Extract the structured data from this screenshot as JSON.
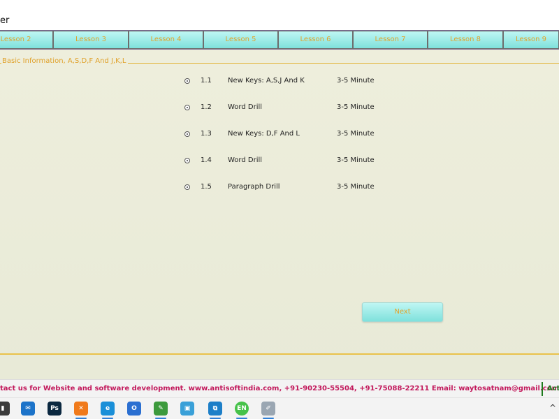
{
  "window": {
    "title_fragment": "er"
  },
  "tabs": [
    {
      "label": "Lesson 2"
    },
    {
      "label": "Lesson 3"
    },
    {
      "label": "Lesson 4"
    },
    {
      "label": "Lesson 5"
    },
    {
      "label": "Lesson 6"
    },
    {
      "label": "Lesson 7"
    },
    {
      "label": "Lesson 8"
    },
    {
      "label": "Lesson 9"
    }
  ],
  "group": {
    "label": "Basic Information, A,S,D,F And J,K,L"
  },
  "lessons": [
    {
      "num": "1.1",
      "title": "New Keys: A,S,J And K",
      "duration": "3-5 Minute"
    },
    {
      "num": "1.2",
      "title": "Word Drill",
      "duration": "3-5 Minute"
    },
    {
      "num": "1.3",
      "title": "New Keys: D,F And L",
      "duration": "3-5 Minute"
    },
    {
      "num": "1.4",
      "title": "Word Drill",
      "duration": "3-5 Minute"
    },
    {
      "num": "1.5",
      "title": "Paragraph Drill",
      "duration": "3-5 Minute"
    }
  ],
  "next_button": {
    "label": "Next"
  },
  "footer": {
    "contact_text": "tact us for Website and software development. www.antisoftindia.com, +91-90230-55504, +91-75088-22211  Email: waytosatnam@gmail.com",
    "right_text": "Act"
  },
  "taskbar": {
    "icons": [
      {
        "name": "store-icon",
        "glyph": "▮",
        "color": "#3a3a3a"
      },
      {
        "name": "mail-icon",
        "glyph": "✉",
        "color": "#1c73c9"
      },
      {
        "name": "photoshop-icon",
        "glyph": "Ps",
        "color": "#0b2840"
      },
      {
        "name": "xampp-icon",
        "glyph": "✕",
        "color": "#f07a1b"
      },
      {
        "name": "edge-icon",
        "glyph": "e",
        "color": "#1a8fd8"
      },
      {
        "name": "outlook-icon",
        "glyph": "O",
        "color": "#2b6fd1"
      },
      {
        "name": "notepad-icon",
        "glyph": "✎",
        "color": "#3c9a3c"
      },
      {
        "name": "remote-desktop-icon",
        "glyph": "▣",
        "color": "#3aa0d8"
      },
      {
        "name": "quick-assist-icon",
        "glyph": "⧉",
        "color": "#1d7fc8"
      },
      {
        "name": "typing-tutor-icon",
        "glyph": "EN",
        "color": "#46c24a"
      },
      {
        "name": "paint-icon",
        "glyph": "✐",
        "color": "#9aa6b2"
      }
    ],
    "tray_chevron": "^"
  }
}
